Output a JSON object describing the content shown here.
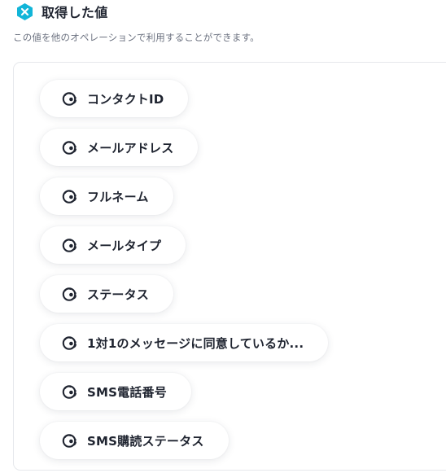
{
  "header": {
    "title": "取得した値",
    "badge_icon": "close-x-hexagon-icon",
    "badge_color": "#12b5d8"
  },
  "description": "この値を他のオペレーションで利用することができます。",
  "values": [
    {
      "label": "コンタクトID",
      "icon": "mailchimp-icon"
    },
    {
      "label": "メールアドレス",
      "icon": "mailchimp-icon"
    },
    {
      "label": "フルネーム",
      "icon": "mailchimp-icon"
    },
    {
      "label": "メールタイプ",
      "icon": "mailchimp-icon"
    },
    {
      "label": "ステータス",
      "icon": "mailchimp-icon"
    },
    {
      "label": "1対1のメッセージに同意しているか...",
      "icon": "mailchimp-icon"
    },
    {
      "label": "SMS電話番号",
      "icon": "mailchimp-icon"
    },
    {
      "label": "SMS購読ステータス",
      "icon": "mailchimp-icon"
    }
  ]
}
